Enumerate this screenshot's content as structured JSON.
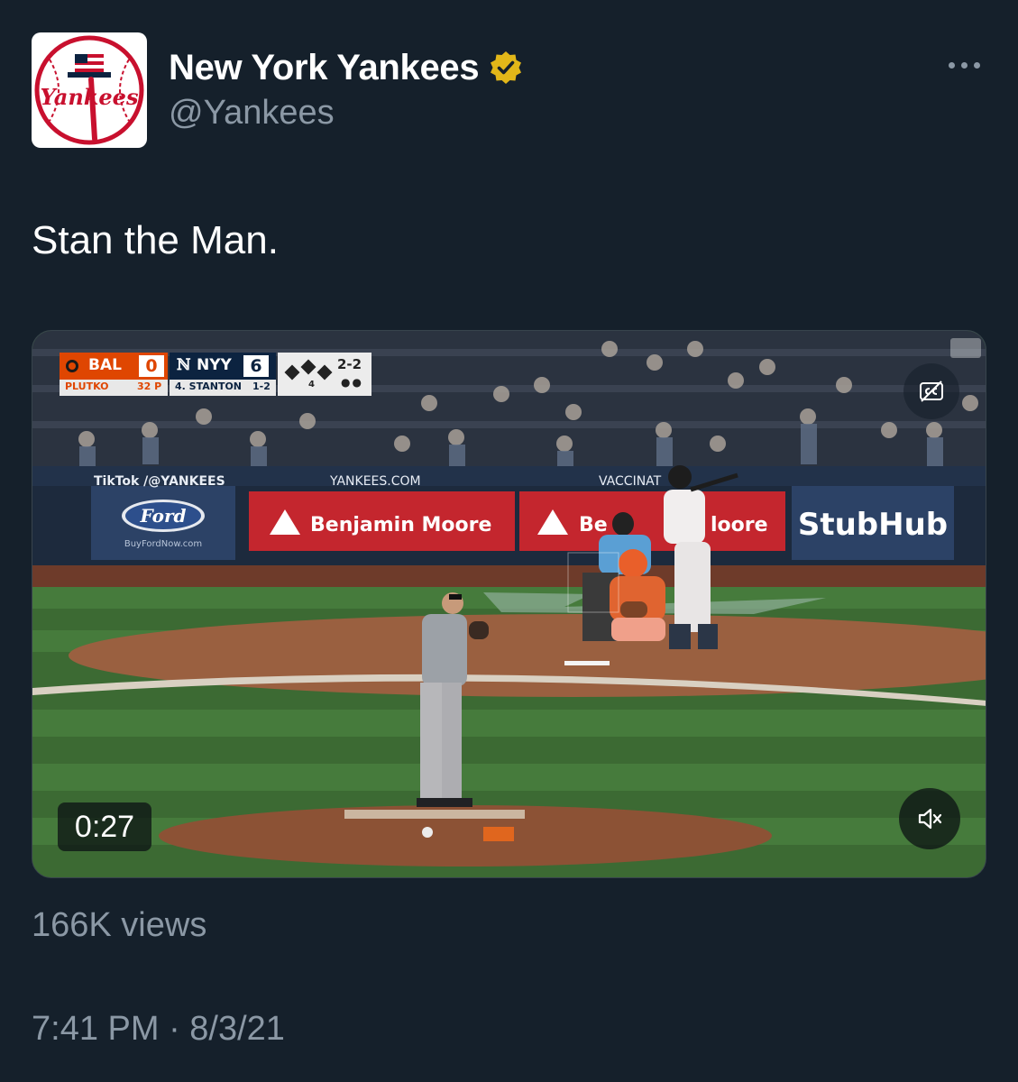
{
  "author": {
    "display_name": "New York Yankees",
    "handle": "@Yankees",
    "verified_badge_icon": "verified-badge-icon",
    "avatar_logo_text": "Yankees"
  },
  "tweet": {
    "text": "Stan the Man."
  },
  "media": {
    "duration": "0:27",
    "scorebug": {
      "away_team": "BAL",
      "away_score": "0",
      "away_pitcher": "PLUTKO",
      "pitch_count": "32 P",
      "home_team": "NYY",
      "home_score": "6",
      "batter": "4. STANTON",
      "batter_stats": "1-2",
      "count": "2-2",
      "inning": "4"
    },
    "signage": {
      "tiktok": "TikTok /@YANKEES",
      "yankees_com": "YANKEES.COM",
      "vaccinat": "VACCINAT",
      "ford": "Ford",
      "ford_url": "BuyFordNow.com",
      "benjamin_moore_1": "Benjamin Moore",
      "benjamin_moore_2_left": "Be",
      "benjamin_moore_2_right": "loore",
      "stubhub": "StubHub"
    }
  },
  "stats": {
    "views": "166K views"
  },
  "meta": {
    "timestamp": "7:41 PM · 8/3/21"
  },
  "colors": {
    "background": "#15202b",
    "secondary_text": "#8b98a5",
    "verified_gold": "#e2b719",
    "orioles_orange": "#df4601",
    "yankees_navy": "#0c2340"
  }
}
